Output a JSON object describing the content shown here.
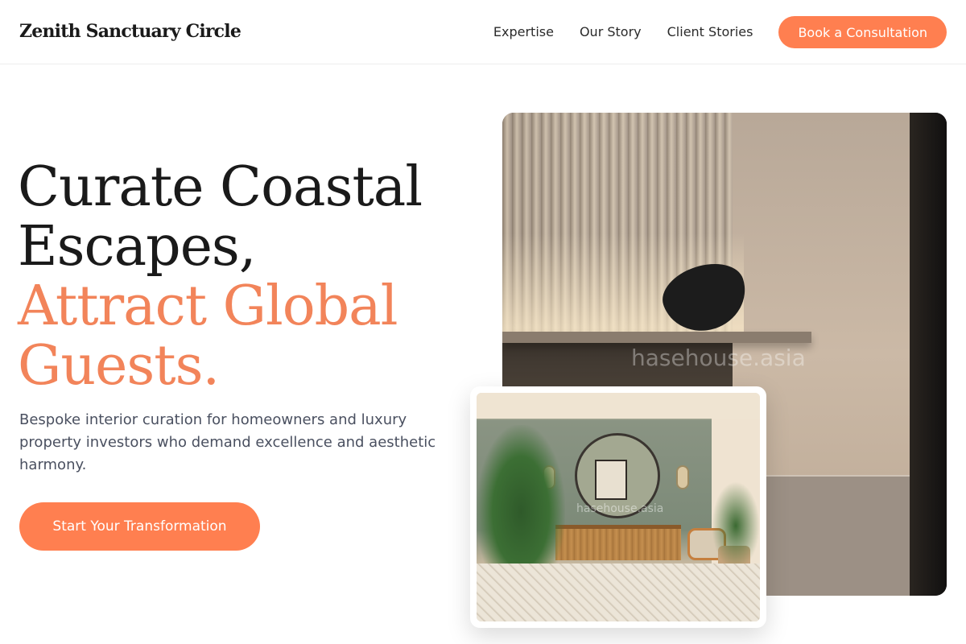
{
  "header": {
    "brand": "Zenith Sanctuary Circle",
    "nav": [
      "Expertise",
      "Our Story",
      "Client Stories"
    ],
    "cta": "Book a Consultation"
  },
  "hero": {
    "title_line1": "Curate Coastal",
    "title_line2": "Escapes,",
    "title_accent1": "Attract Global",
    "title_accent2": "Guests.",
    "subtitle": "Bespoke interior curation for homeowners and luxury property investors who demand excellence and aesthetic harmony.",
    "cta": "Start Your Transformation"
  },
  "images": {
    "main_watermark": "hasehouse.asia",
    "inset_watermark": "hasehouse.asia"
  },
  "colors": {
    "accent": "#ff7f50",
    "accent_text": "#f2845a",
    "heading": "#1a1a1a",
    "body_text": "#4a5060"
  }
}
